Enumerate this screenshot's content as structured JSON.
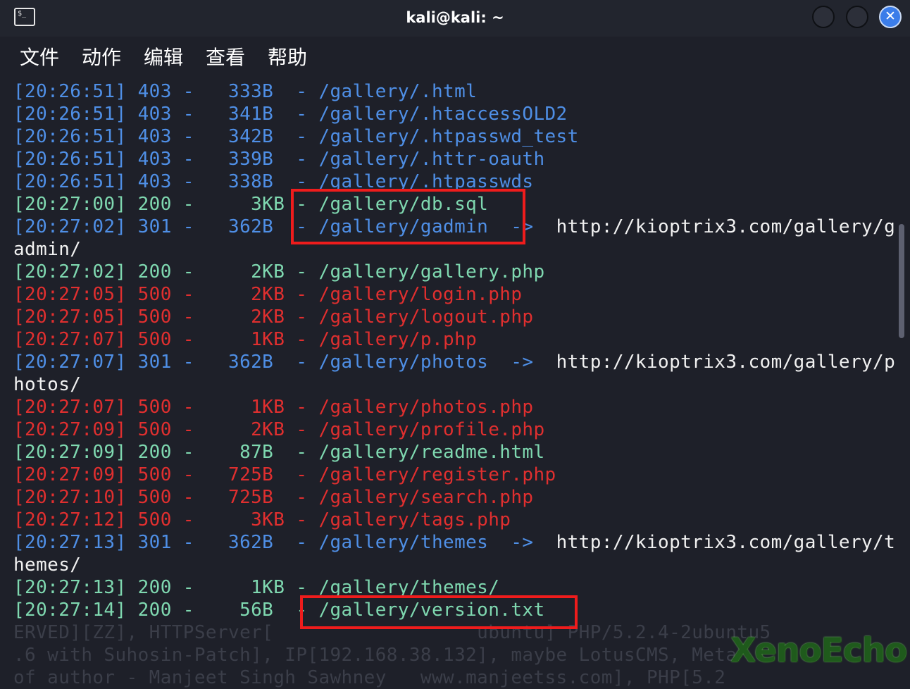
{
  "window": {
    "title": "kali@kali: ~",
    "terminal_icon": "terminal-prompt-icon",
    "close_symbol": "✕"
  },
  "menu": [
    "文件",
    "动作",
    "编辑",
    "查看",
    "帮助"
  ],
  "colors": {
    "redirect": "#4f8fe6",
    "ok": "#7fd8b0",
    "error": "#e02f2f",
    "highlight_box": "#ef1c1c",
    "background": "#1e2029"
  },
  "lines": [
    {
      "text": "[20:26:51] 403 -   333B  - /gallery/.html",
      "color": "blue"
    },
    {
      "text": "[20:26:51] 403 -   341B  - /gallery/.htaccessOLD2",
      "color": "blue"
    },
    {
      "text": "[20:26:51] 403 -   342B  - /gallery/.htpasswd_test",
      "color": "blue"
    },
    {
      "text": "[20:26:51] 403 -   339B  - /gallery/.httr-oauth",
      "color": "blue"
    },
    {
      "text": "[20:26:51] 403 -   338B  - /gallery/.htpasswds",
      "color": "blue"
    },
    {
      "text": "[20:27:00] 200 -     3KB - /gallery/db.sql",
      "color": "green"
    },
    {
      "text": "[20:27:02] 301 -   362B  - /gallery/gadmin  ->  ",
      "color": "blue",
      "suffix": "http://kioptrix3.com/gallery/g"
    },
    {
      "text": "admin/",
      "color": "white"
    },
    {
      "text": "[20:27:02] 200 -     2KB - /gallery/gallery.php",
      "color": "green"
    },
    {
      "text": "[20:27:05] 500 -     2KB - /gallery/login.php",
      "color": "red"
    },
    {
      "text": "[20:27:05] 500 -     2KB - /gallery/logout.php",
      "color": "red"
    },
    {
      "text": "[20:27:07] 500 -     1KB - /gallery/p.php",
      "color": "red"
    },
    {
      "text": "[20:27:07] 301 -   362B  - /gallery/photos  ->  ",
      "color": "blue",
      "suffix": "http://kioptrix3.com/gallery/p"
    },
    {
      "text": "hotos/",
      "color": "white"
    },
    {
      "text": "[20:27:07] 500 -     1KB - /gallery/photos.php",
      "color": "red"
    },
    {
      "text": "[20:27:09] 500 -     2KB - /gallery/profile.php",
      "color": "red"
    },
    {
      "text": "[20:27:09] 200 -    87B  - /gallery/readme.html",
      "color": "green"
    },
    {
      "text": "[20:27:09] 500 -   725B  - /gallery/register.php",
      "color": "red"
    },
    {
      "text": "[20:27:10] 500 -   725B  - /gallery/search.php",
      "color": "red"
    },
    {
      "text": "[20:27:12] 500 -     3KB - /gallery/tags.php",
      "color": "red"
    },
    {
      "text": "[20:27:13] 301 -   362B  - /gallery/themes  ->  ",
      "color": "blue",
      "suffix": "http://kioptrix3.com/gallery/t"
    },
    {
      "text": "hemes/",
      "color": "white"
    },
    {
      "text": "[20:27:13] 200 -     1KB - /gallery/themes/",
      "color": "green"
    },
    {
      "text": "[20:27:14] 200 -    56B  - /gallery/version.txt",
      "color": "green"
    },
    {
      "text": "ERVED][ZZ], HTTPServer[                  ubuntu] PHP/5.2.4-2ubuntu5",
      "color": "dim"
    },
    {
      "text": ".6 with Suhosin-Patch], IP[192.168.38.132], maybe LotusCMS, Meta",
      "color": "dim"
    },
    {
      "text": "of author - Manjeet Singh Sawhney   www.manjeetss.com], PHP[5.2",
      "color": "dim"
    }
  ],
  "watermark": "XenoEcho"
}
